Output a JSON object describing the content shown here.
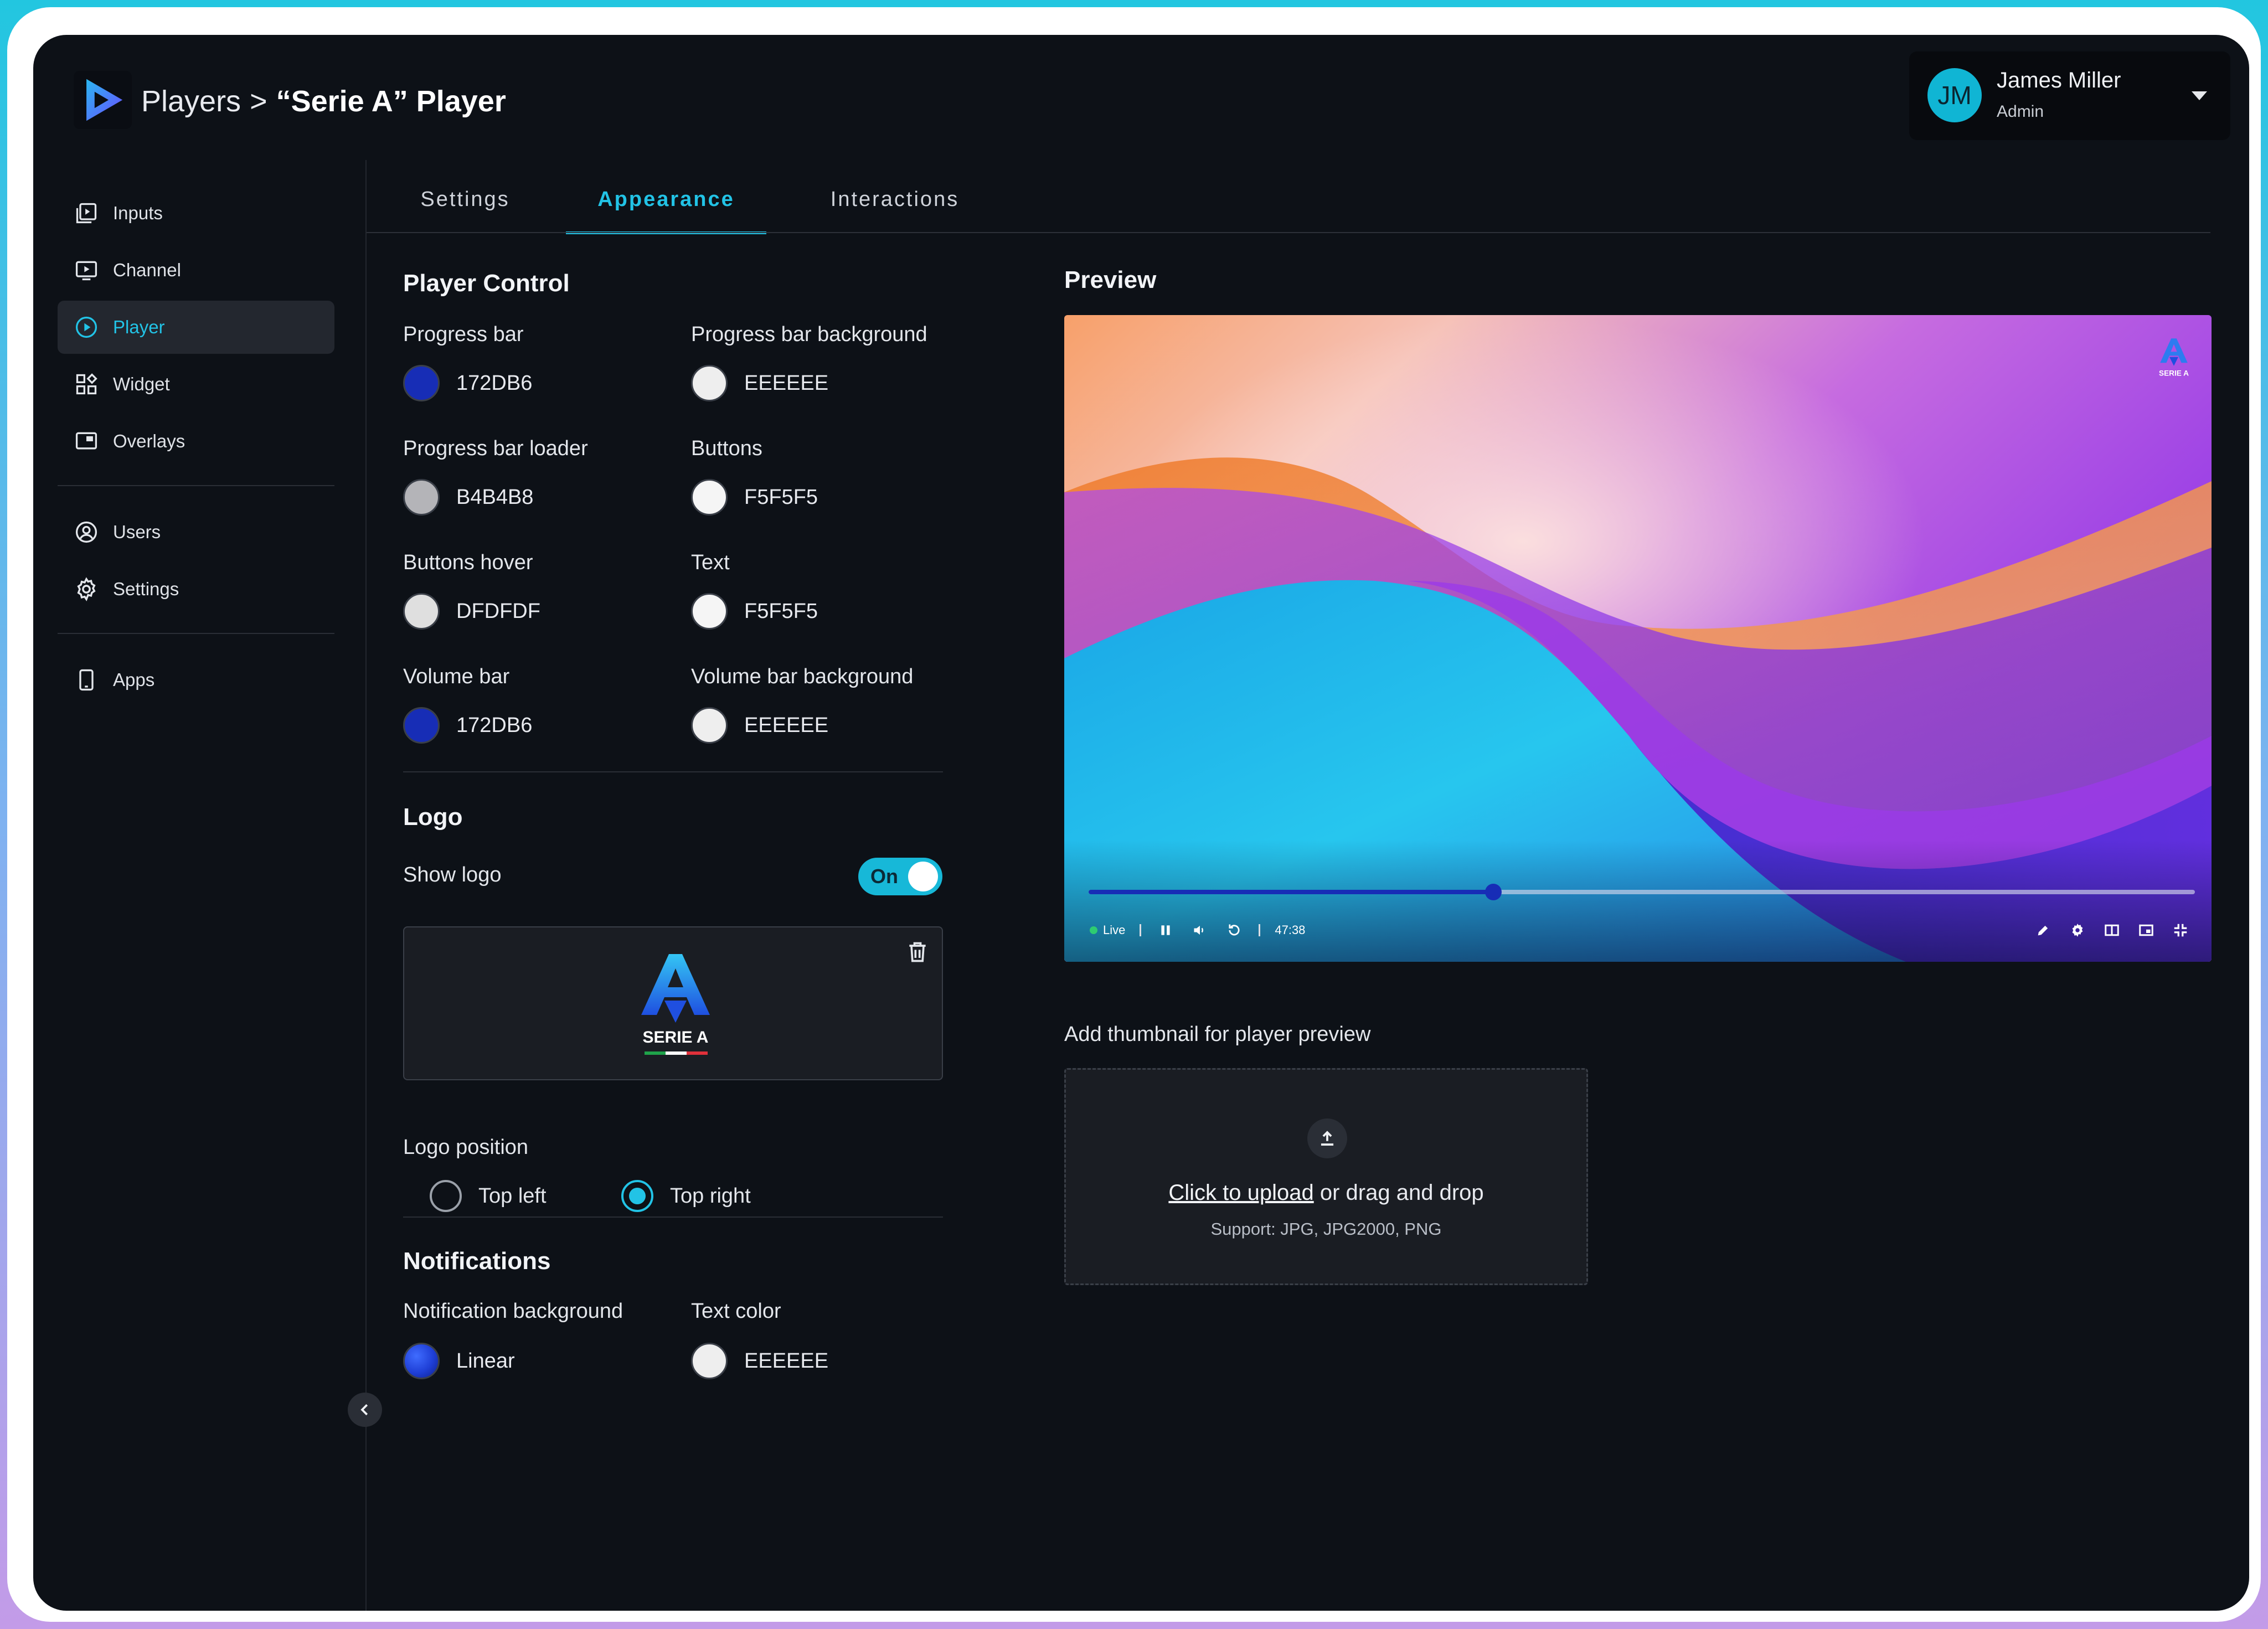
{
  "header": {
    "breadcrumb_parent": "Players",
    "breadcrumb_separator": ">",
    "breadcrumb_current": "“Serie A” Player"
  },
  "user": {
    "initials": "JM",
    "name": "James Miller",
    "role": "Admin"
  },
  "sidebar": {
    "items": [
      {
        "label": "Inputs",
        "icon": "inputs-icon"
      },
      {
        "label": "Channel",
        "icon": "channel-icon"
      },
      {
        "label": "Player",
        "icon": "player-icon",
        "active": true
      },
      {
        "label": "Widget",
        "icon": "widget-icon"
      },
      {
        "label": "Overlays",
        "icon": "overlays-icon"
      },
      {
        "label": "Users",
        "icon": "users-icon"
      },
      {
        "label": "Settings",
        "icon": "settings-icon"
      },
      {
        "label": "Apps",
        "icon": "apps-icon"
      }
    ]
  },
  "tabs": [
    {
      "label": "Settings"
    },
    {
      "label": "Appearance",
      "active": true
    },
    {
      "label": "Interactions"
    }
  ],
  "player_control": {
    "title": "Player Control",
    "fields": [
      {
        "label": "Progress bar",
        "value": "172DB6",
        "color": "#172DB6"
      },
      {
        "label": "Progress bar background",
        "value": "EEEEEE",
        "color": "#EEEEEE"
      },
      {
        "label": "Progress bar loader",
        "value": "B4B4B8",
        "color": "#B4B4B8"
      },
      {
        "label": "Buttons",
        "value": "F5F5F5",
        "color": "#F5F5F5"
      },
      {
        "label": "Buttons hover",
        "value": "DFDFDF",
        "color": "#DFDFDF"
      },
      {
        "label": "Text",
        "value": "F5F5F5",
        "color": "#F5F5F5"
      },
      {
        "label": "Volume bar",
        "value": "172DB6",
        "color": "#172DB6"
      },
      {
        "label": "Volume bar background",
        "value": "EEEEEE",
        "color": "#EEEEEE"
      }
    ]
  },
  "logo": {
    "title": "Logo",
    "show_logo_label": "Show logo",
    "toggle_label": "On",
    "toggle_on": true,
    "image_text": "SERIE A",
    "position_label": "Logo position",
    "position_options": [
      {
        "label": "Top left",
        "checked": false
      },
      {
        "label": "Top right",
        "checked": true
      }
    ]
  },
  "notifications": {
    "title": "Notifications",
    "fields": [
      {
        "label": "Notification background",
        "value": "Linear"
      },
      {
        "label": "Text color",
        "value": "EEEEEE",
        "color": "#EEEEEE"
      }
    ]
  },
  "preview": {
    "title": "Preview",
    "live_label": "Live",
    "time": "47:38",
    "progress_fraction": 0.366,
    "logo_text": "SERIE A"
  },
  "thumbnail": {
    "label": "Add thumbnail for player preview",
    "link_text": "Click to upload",
    "rest_text": " or drag and drop",
    "support_text": "Support: JPG, JPG2000, PNG"
  },
  "colors": {
    "accent": "#22C3E6",
    "background": "#0D1117",
    "progress": "#172DB6"
  }
}
